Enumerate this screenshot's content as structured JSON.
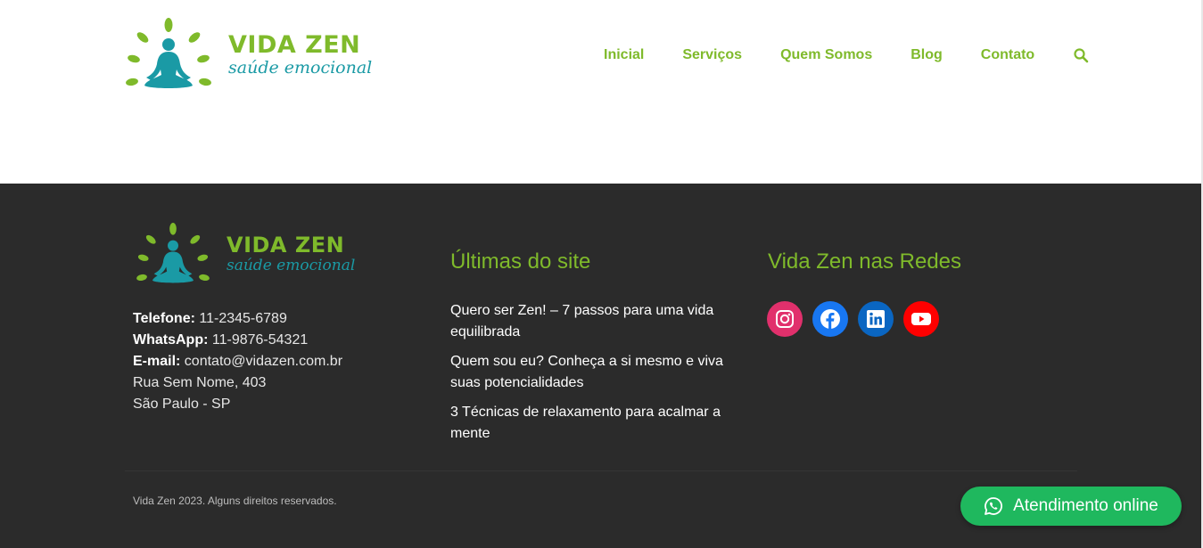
{
  "brand": {
    "name": "VIDA ZEN",
    "tagline": "saúde emocional",
    "colors": {
      "green": "#7fba2b",
      "teal": "#1a9aa5"
    }
  },
  "nav": {
    "items": [
      {
        "label": "Inicial"
      },
      {
        "label": "Serviços"
      },
      {
        "label": "Quem Somos"
      },
      {
        "label": "Blog"
      },
      {
        "label": "Contato"
      }
    ],
    "search_icon": "search-icon"
  },
  "footer": {
    "contact": {
      "phone_label": "Telefone:",
      "phone": "11-2345-6789",
      "whatsapp_label": "WhatsApp:",
      "whatsapp": "11-9876-54321",
      "email_label": "E-mail:",
      "email": "contato@vidazen.com.br",
      "address": "Rua Sem Nome, 403",
      "city": "São Paulo - SP"
    },
    "latest": {
      "title": "Últimas do site",
      "posts": [
        {
          "title": "Quero ser Zen! – 7 passos para uma vida equilibrada"
        },
        {
          "title": "Quem sou eu? Conheça a si mesmo e viva suas potencialidades"
        },
        {
          "title": "3 Técnicas de relaxamento para acalmar a mente"
        }
      ]
    },
    "social": {
      "title": "Vida Zen nas Redes",
      "links": [
        {
          "icon": "instagram-icon",
          "color": "#e1306c"
        },
        {
          "icon": "facebook-icon",
          "color": "#1877f2"
        },
        {
          "icon": "linkedin-icon",
          "color": "#0a66c2"
        },
        {
          "icon": "youtube-icon",
          "color": "#ff0000"
        }
      ]
    },
    "copyright": "Vida Zen 2023. Alguns direitos reservados.",
    "chat": {
      "label": "Atendimento online",
      "icon": "whatsapp-icon",
      "color": "#1fb85e"
    }
  }
}
